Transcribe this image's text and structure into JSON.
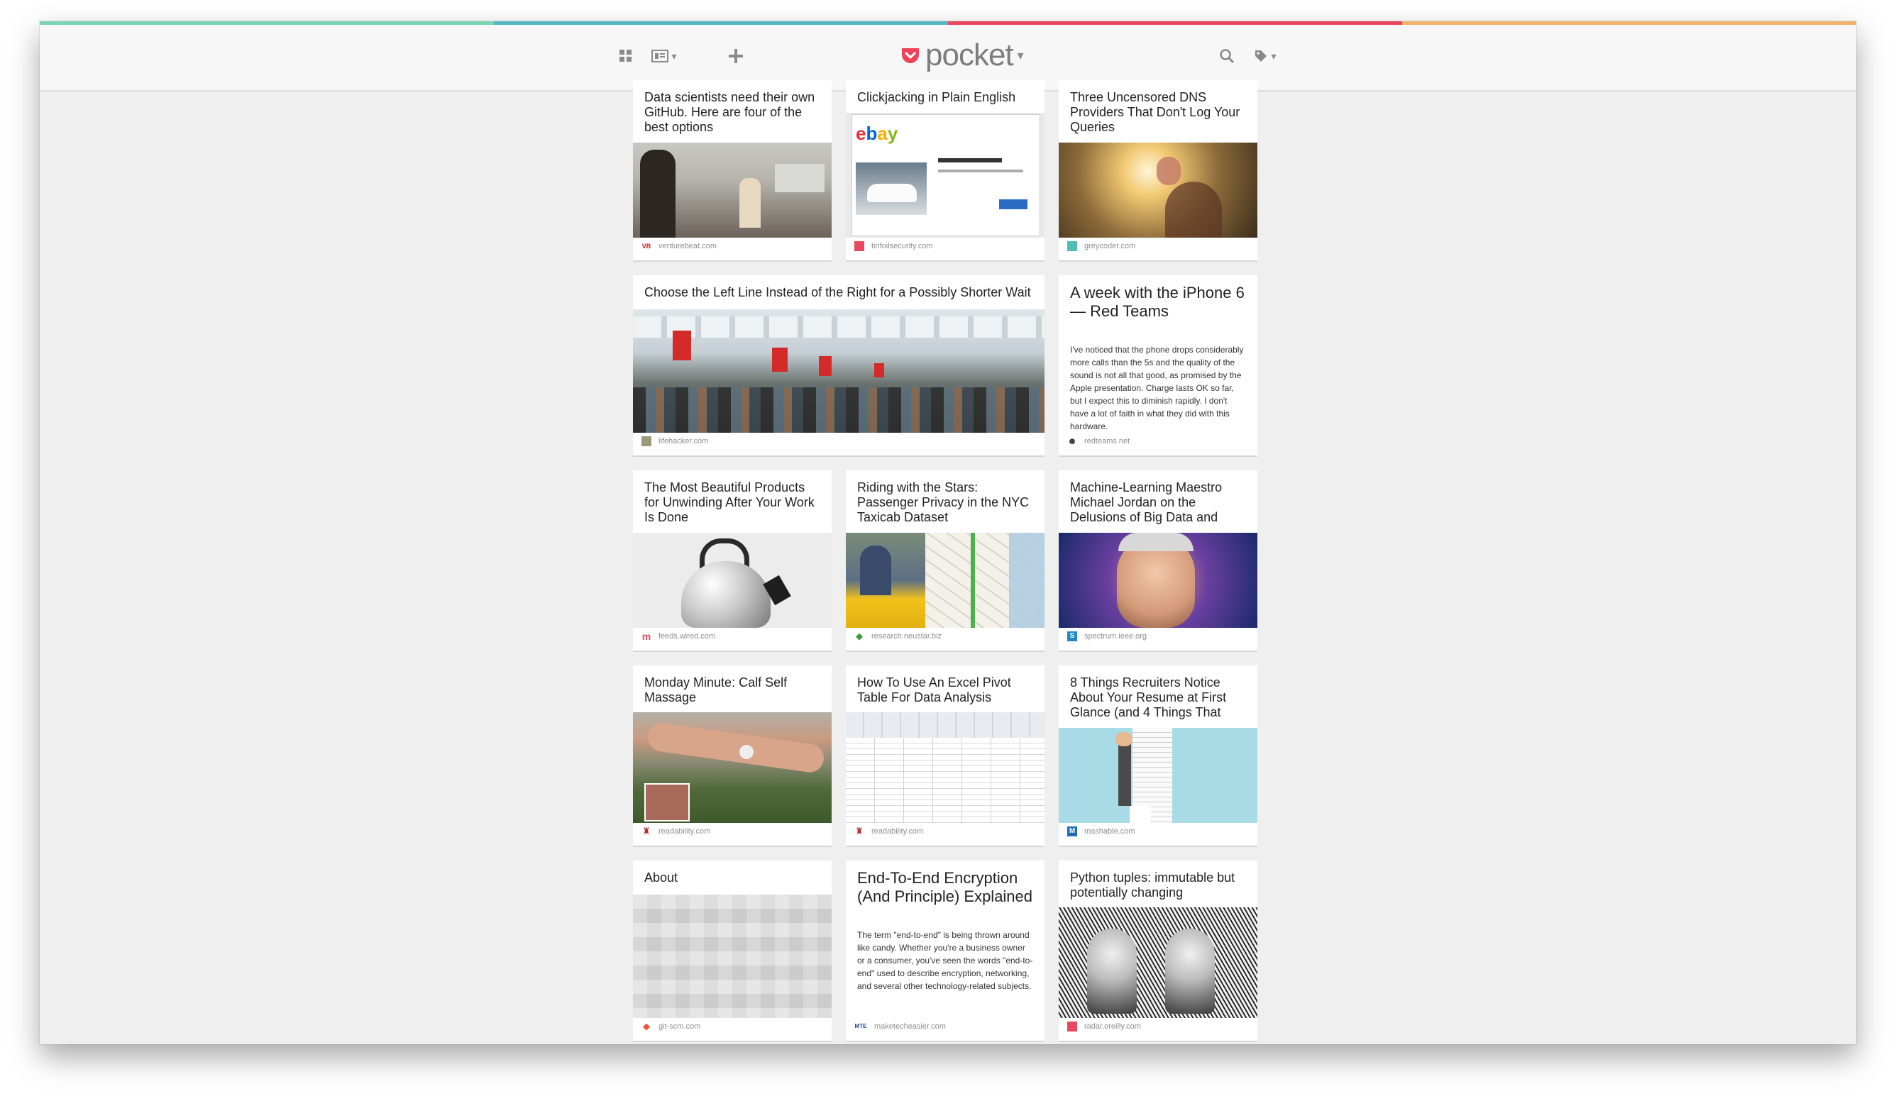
{
  "colors": {
    "bar": [
      "#7dd3b6",
      "#55b7c2",
      "#e8485e",
      "#f2b06b"
    ],
    "accent": "#ee4056",
    "logo_text": "#7d7d7d"
  },
  "topbar": {
    "logo_text": "pocket",
    "list_view_icon": "list-view-icon",
    "tile_view_icon": "tile-view-icon",
    "add_icon": "plus-icon",
    "search_icon": "search-icon",
    "tag_icon": "tag-icon"
  },
  "cards": [
    {
      "title": "Data scientists need their own GitHub. Here are four of the best options",
      "source": "venturebeat.com",
      "fav": "VB"
    },
    {
      "title": "Clickjacking in Plain English",
      "source": "tinfoilsecurity.com",
      "fav": ""
    },
    {
      "title": "Three Uncensored DNS Providers That Don't Log Your Queries",
      "source": "greycoder.com",
      "fav": ""
    },
    {
      "title": "Choose the Left Line Instead of the Right for a Possibly Shorter Wait",
      "source": "lifehacker.com",
      "fav": ""
    },
    {
      "title": "A week with the iPhone 6 — Red Teams",
      "excerpt": "I've noticed that the phone drops considerably more calls than the 5s and the quality of the sound is not all that good, as promised by the Apple presentation. Charge lasts OK so far, but I expect this to diminish rapidly. I don't have a lot of faith in what they did with this hardware.",
      "source": "redteams.net",
      "fav": ""
    },
    {
      "title": "The Most Beautiful Products for Unwinding After Your Work Is Done",
      "source": "feeds.wired.com",
      "fav": "m"
    },
    {
      "title": "Riding with the Stars: Passenger Privacy in the NYC Taxicab Dataset",
      "source": "research.neustar.biz",
      "fav": ""
    },
    {
      "title": "Machine-Learning Maestro Michael Jordan on the Delusions of Big Data and",
      "source": "spectrum.ieee.org",
      "fav": "S"
    },
    {
      "title": "Monday Minute: Calf Self Massage",
      "source": "readability.com",
      "fav": ""
    },
    {
      "title": "How To Use An Excel Pivot Table For Data Analysis",
      "source": "readability.com",
      "fav": ""
    },
    {
      "title": "8 Things Recruiters Notice About Your Resume at First Glance (and 4 Things That",
      "source": "mashable.com",
      "fav": "M"
    },
    {
      "title": "About",
      "source": "git-scm.com",
      "fav": ""
    },
    {
      "title": "End-To-End Encryption (And Principle) Explained",
      "excerpt": "The term \"end-to-end\" is being thrown around like candy. Whether you're a business owner or a consumer, you've seen the words \"end-to-end\" used to describe encryption, networking, and several other technology-related subjects.",
      "source": "maketecheasier.com",
      "fav": "MTE"
    },
    {
      "title": "Python tuples: immutable but potentially changing",
      "source": "radar.oreilly.com",
      "fav": ""
    }
  ]
}
